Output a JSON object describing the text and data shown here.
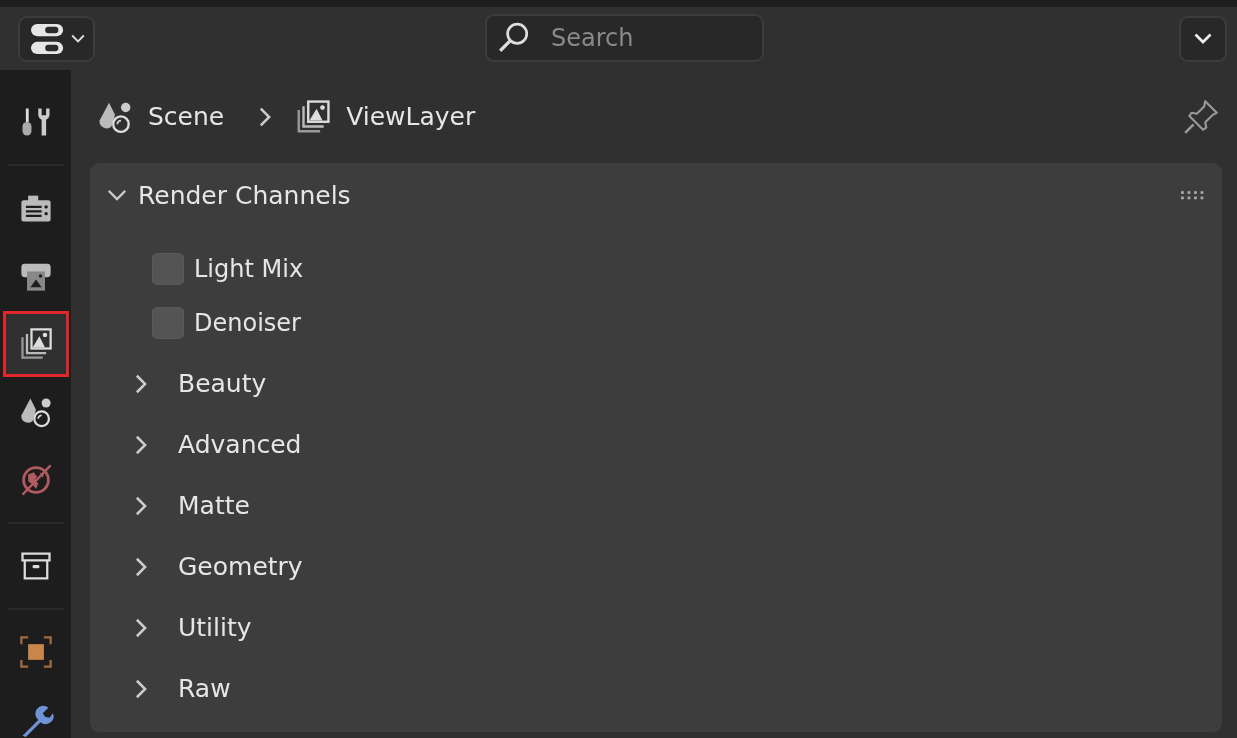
{
  "header": {
    "search": {
      "placeholder": "Search"
    }
  },
  "sidebar": {
    "groups": [
      {
        "tabs": [
          {
            "kind": "tool",
            "selected": false
          }
        ]
      },
      {
        "tabs": [
          {
            "kind": "render",
            "selected": false
          },
          {
            "kind": "output",
            "selected": false
          },
          {
            "kind": "view_layer",
            "selected": true
          },
          {
            "kind": "scene",
            "selected": false
          },
          {
            "kind": "world",
            "selected": false
          }
        ]
      },
      {
        "tabs": [
          {
            "kind": "collection",
            "selected": false
          }
        ]
      },
      {
        "tabs": [
          {
            "kind": "object",
            "selected": false
          },
          {
            "kind": "modifier",
            "selected": false
          }
        ]
      }
    ]
  },
  "breadcrumb": [
    {
      "kind": "scene",
      "label": "Scene"
    },
    {
      "kind": "view_layer",
      "label": "ViewLayer"
    }
  ],
  "panel": {
    "title": "Render Channels",
    "expanded": true,
    "options": [
      {
        "label": "Light Mix",
        "checked": false
      },
      {
        "label": "Denoiser",
        "checked": false
      }
    ],
    "subpanels": [
      {
        "label": "Beauty",
        "expanded": false
      },
      {
        "label": "Advanced",
        "expanded": false
      },
      {
        "label": "Matte",
        "expanded": false
      },
      {
        "label": "Geometry",
        "expanded": false
      },
      {
        "label": "Utility",
        "expanded": false
      },
      {
        "label": "Raw",
        "expanded": false
      }
    ]
  }
}
